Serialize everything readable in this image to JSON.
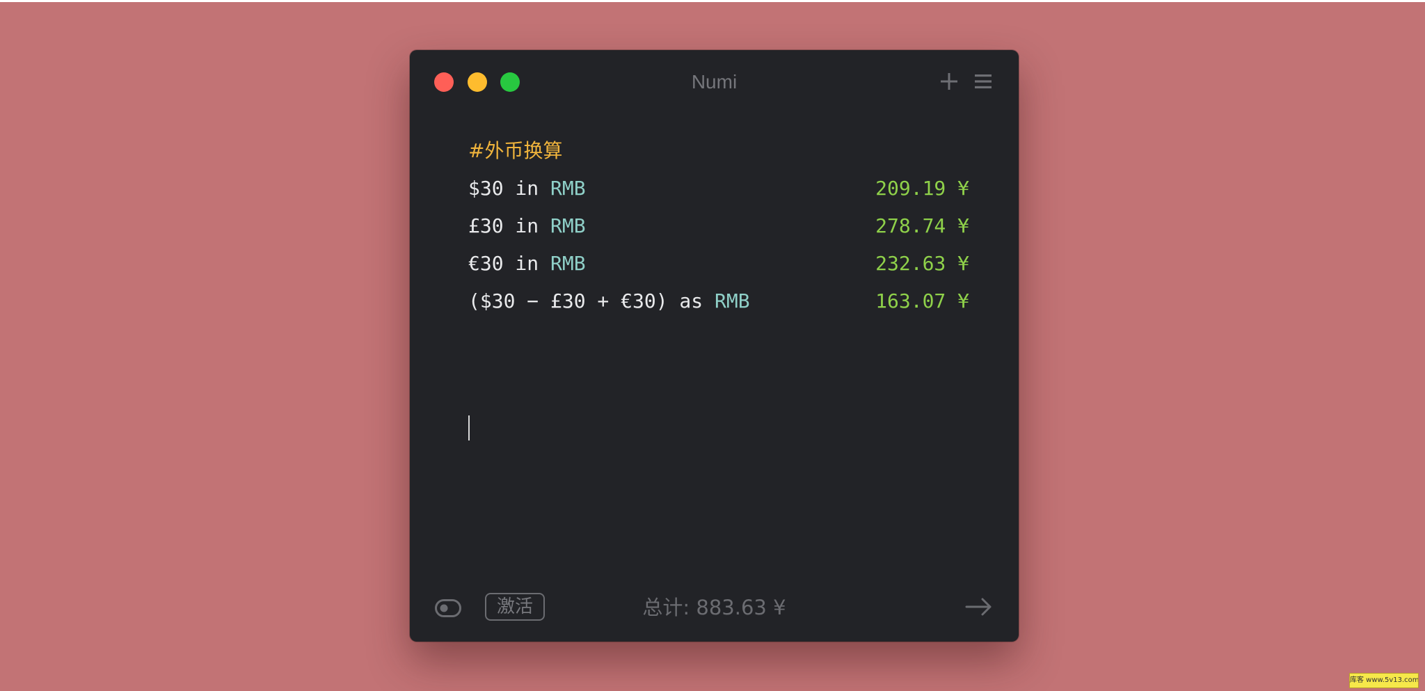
{
  "window": {
    "title": "Numi"
  },
  "editor": {
    "heading": "#外币换算",
    "lines": [
      {
        "parts": [
          {
            "text": "$30 in ",
            "kind": "expr"
          },
          {
            "text": "RMB",
            "kind": "unit"
          }
        ],
        "result": "209.19 ¥"
      },
      {
        "parts": [
          {
            "text": "£30 in ",
            "kind": "expr"
          },
          {
            "text": "RMB",
            "kind": "unit"
          }
        ],
        "result": "278.74 ¥"
      },
      {
        "parts": [
          {
            "text": "€30 in ",
            "kind": "expr"
          },
          {
            "text": "RMB",
            "kind": "unit"
          }
        ],
        "result": "232.63 ¥"
      },
      {
        "parts": [
          {
            "text": "($30 − £30 + €30) as ",
            "kind": "expr"
          },
          {
            "text": "RMB",
            "kind": "unit"
          }
        ],
        "result": "163.07 ¥"
      }
    ]
  },
  "footer": {
    "activate_label": "激活",
    "total": "总计: 883.63 ¥"
  },
  "watermark": {
    "text": "库客 www.5v13.com"
  },
  "icons": {
    "plus": "plus-icon",
    "menu": "menu-icon",
    "toggle": "toggle-icon",
    "arrow": "arrow-right-icon"
  },
  "colors": {
    "background": "#c27375",
    "window": "#222327",
    "heading": "#f0b43c",
    "result": "#8fd14a",
    "unit": "#8fd0c8"
  }
}
